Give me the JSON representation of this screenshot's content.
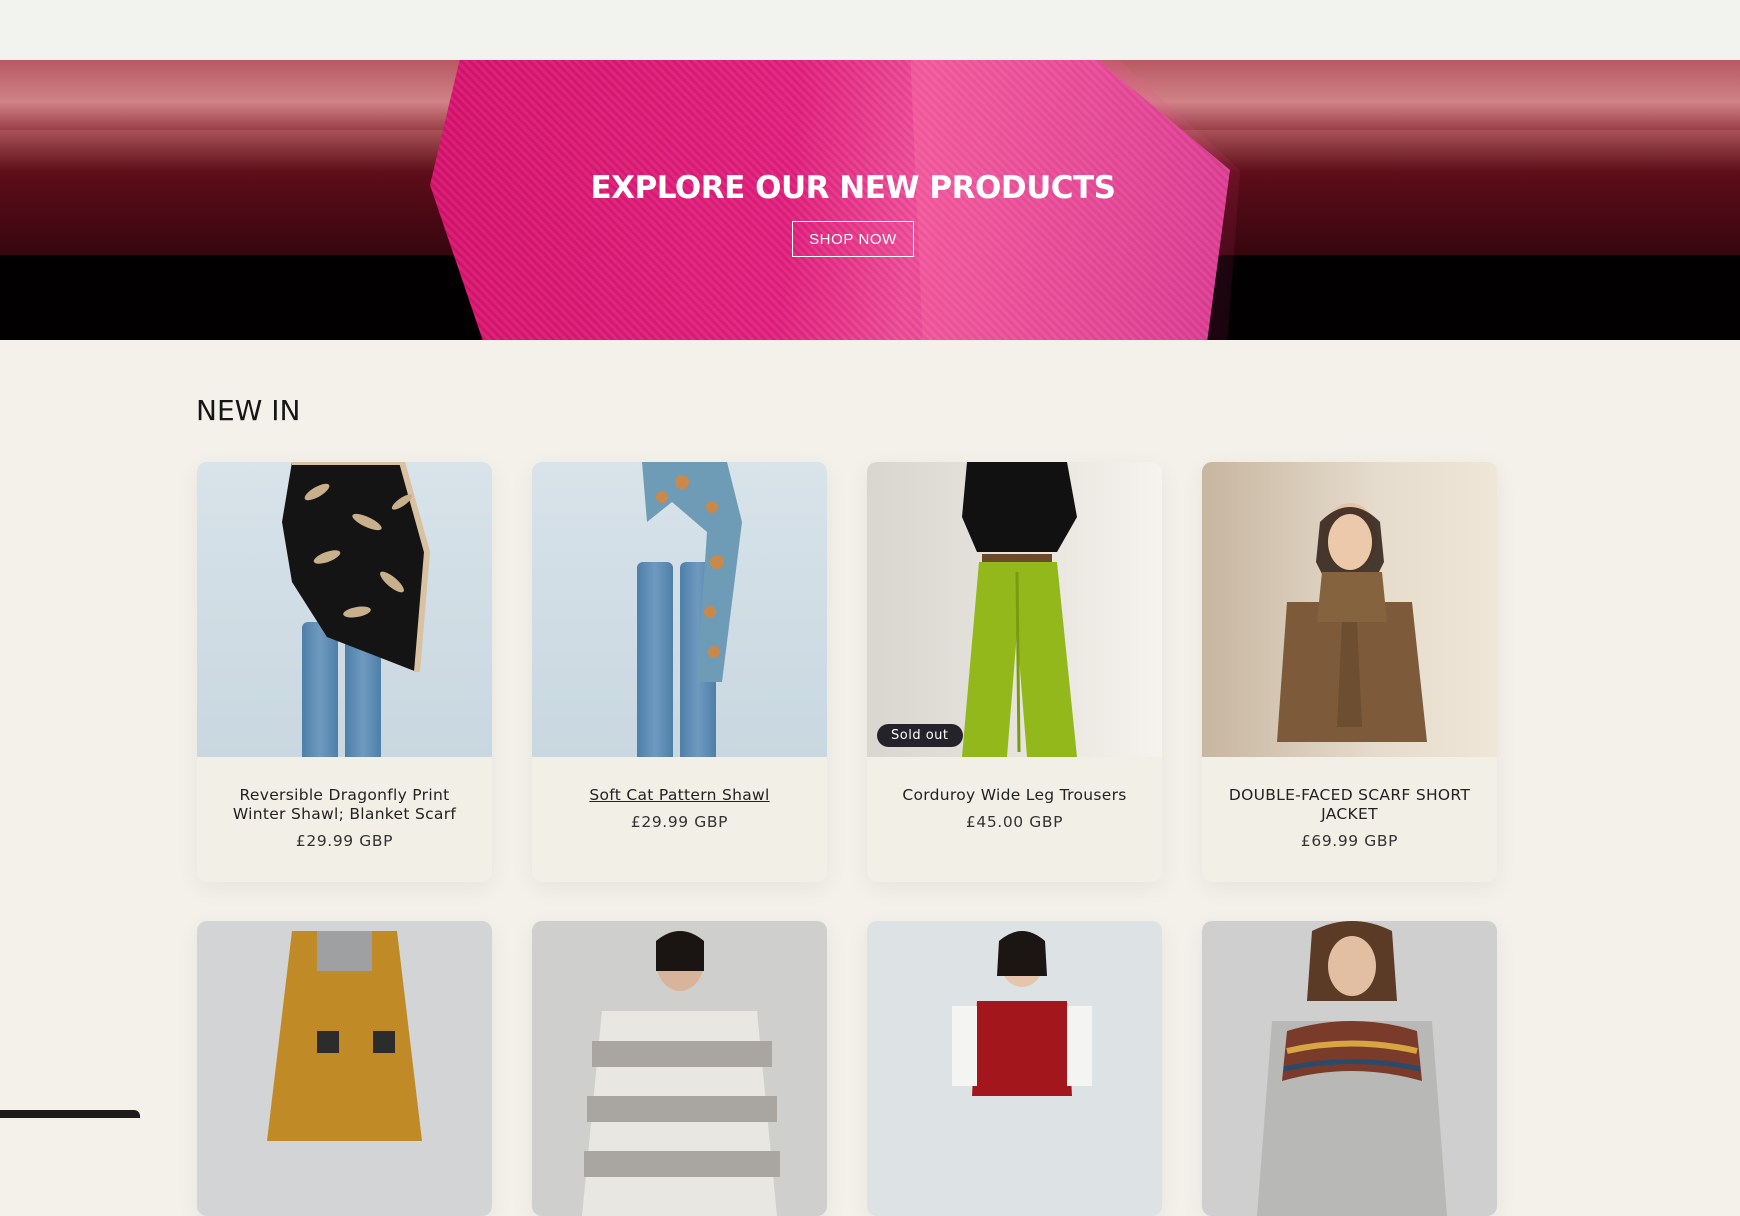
{
  "hero": {
    "title": "EXPLORE OUR NEW PRODUCTS",
    "button_label": "SHOP NOW"
  },
  "section": {
    "title": "NEW IN"
  },
  "products": [
    {
      "title": "Reversible Dragonfly Print Winter Shawl; Blanket Scarf",
      "price": "£29.99 GBP",
      "badge": ""
    },
    {
      "title": "Soft Cat Pattern Shawl",
      "price": "£29.99 GBP",
      "badge": ""
    },
    {
      "title": "Corduroy Wide Leg Trousers",
      "price": "£45.00 GBP",
      "badge": "Sold out"
    },
    {
      "title": "DOUBLE-FACED SCARF SHORT JACKET",
      "price": "£69.99 GBP",
      "badge": ""
    }
  ],
  "colors": {
    "page_background": "#f3f1ea",
    "hero_accent": "#e4207e",
    "badge_background": "#24232a"
  }
}
